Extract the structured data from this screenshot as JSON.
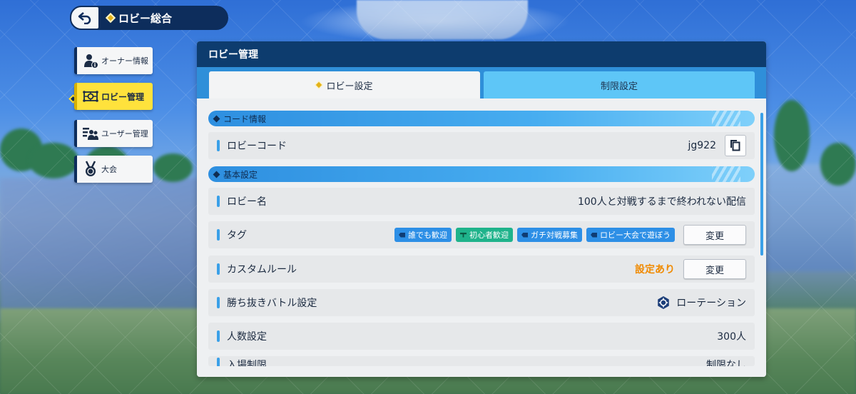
{
  "header": {
    "title": "ロビー総合"
  },
  "sidebar": {
    "items": [
      {
        "label": "オーナー情報",
        "icon": "owner-info-icon"
      },
      {
        "label": "ロビー管理",
        "icon": "lobby-manage-icon",
        "active": true
      },
      {
        "label": "ユーザー管理",
        "icon": "user-manage-icon"
      },
      {
        "label": "大会",
        "icon": "medal-icon"
      }
    ]
  },
  "panel": {
    "title": "ロビー管理",
    "tabs": [
      {
        "label": "ロビー設定",
        "active": true
      },
      {
        "label": "制限設定",
        "active": false
      }
    ],
    "sections": {
      "code": {
        "title": "コード情報"
      },
      "basic": {
        "title": "基本設定"
      }
    },
    "rows": {
      "lobby_code": {
        "label": "ロビーコード",
        "value": "jg922"
      },
      "lobby_name": {
        "label": "ロビー名",
        "value": "100人と対戦するまで終われない配信"
      },
      "tags": {
        "label": "タグ",
        "items": [
          {
            "text": "誰でも歓迎",
            "color": "blue"
          },
          {
            "text": "初心者歓迎",
            "color": "green"
          },
          {
            "text": "ガチ対戦募集",
            "color": "blue"
          },
          {
            "text": "ロビー大会で遊ぼう",
            "color": "blue"
          }
        ],
        "button": "変更"
      },
      "custom_rule": {
        "label": "カスタムルール",
        "value": "設定あり",
        "button": "変更"
      },
      "battle": {
        "label": "勝ち抜きバトル設定",
        "value": "ローテーション"
      },
      "players": {
        "label": "人数設定",
        "value": "300人"
      },
      "entry": {
        "label": "入場制限",
        "value": "制限なし"
      }
    }
  },
  "colors": {
    "accent": "#3aa0e8",
    "active_tab_bg": "#ffe23c",
    "orange": "#f08a00",
    "header_bg": "#0d3c6e"
  }
}
